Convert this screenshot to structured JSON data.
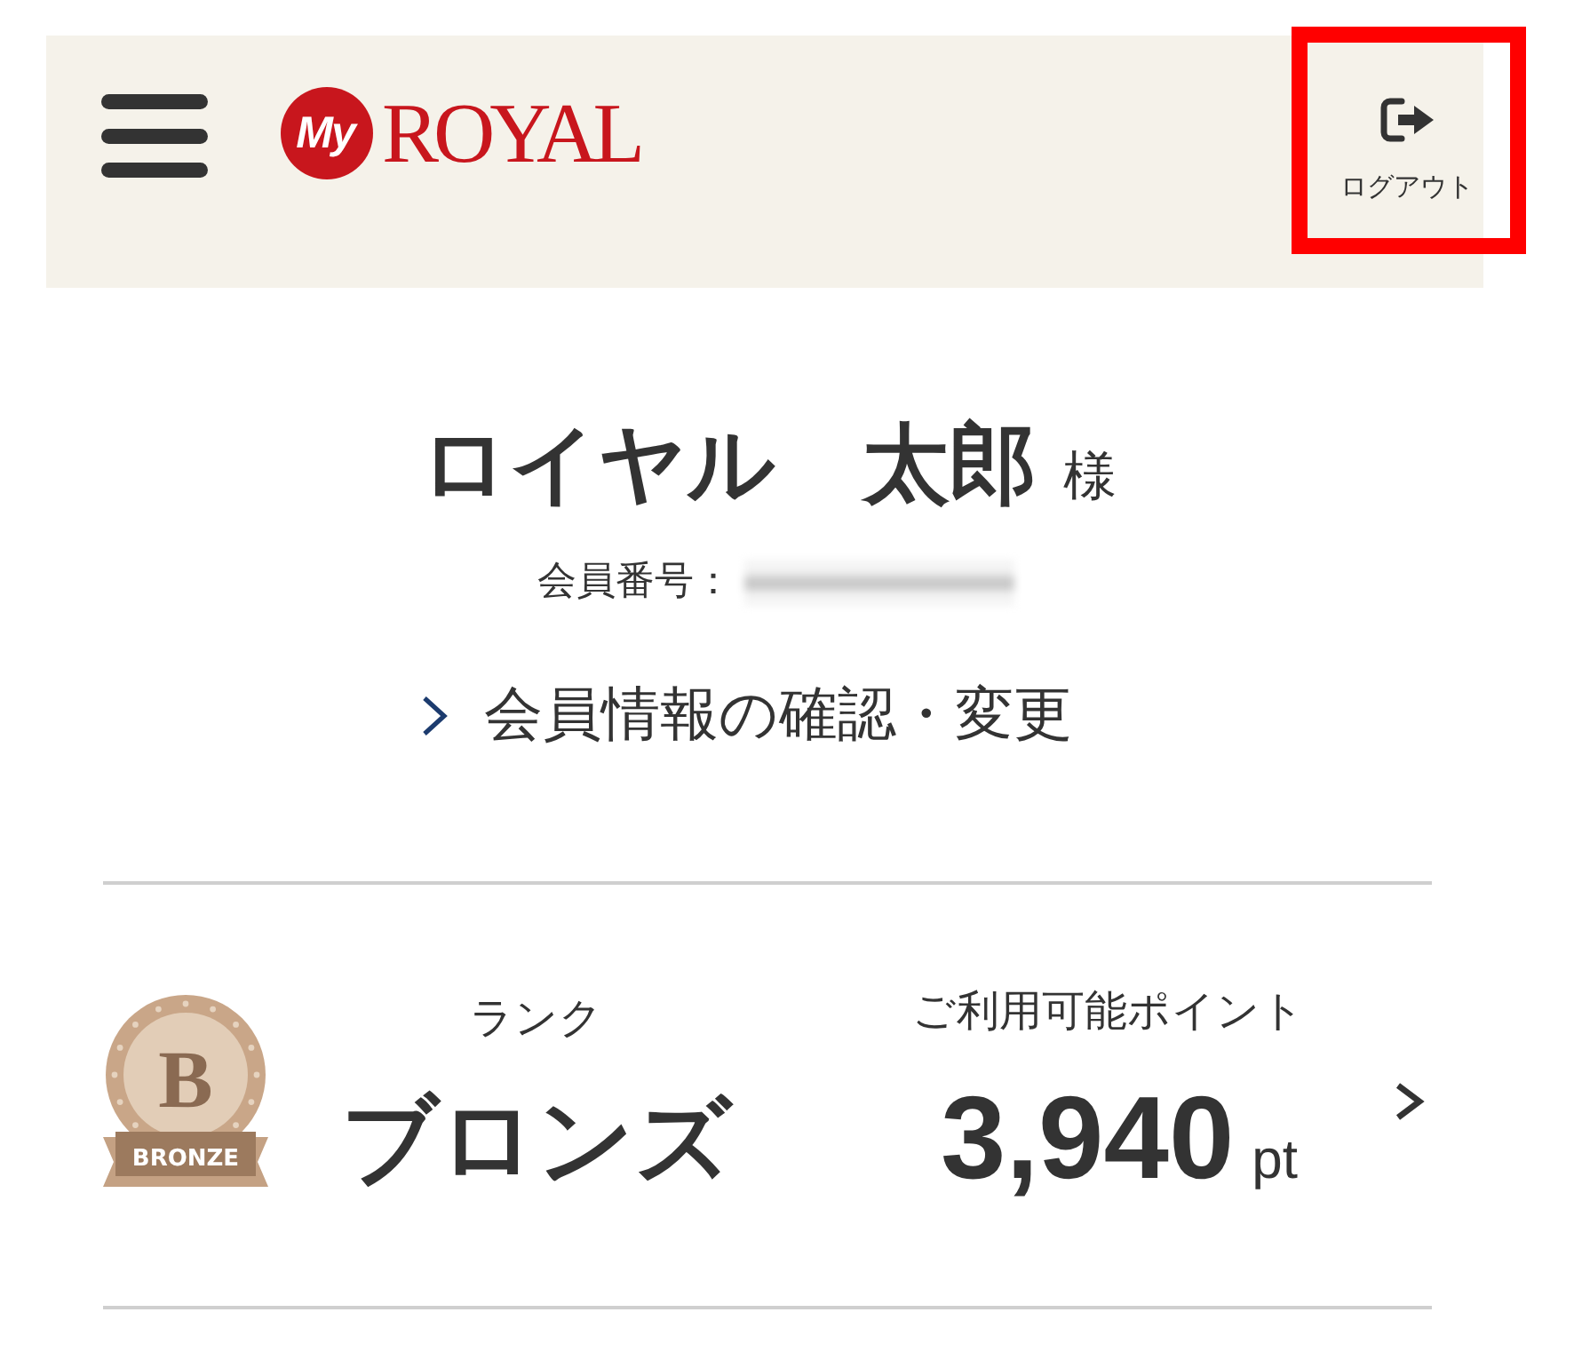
{
  "header": {
    "logo": {
      "emblem": "My",
      "wordmark": "ROYAL"
    },
    "logout": {
      "label": "ログアウト",
      "highlighted": true
    }
  },
  "member": {
    "name": "ロイヤル　太郎",
    "honorific": "様",
    "number_label": "会員番号：",
    "number_redacted": true,
    "info_link": "会員情報の確認・変更"
  },
  "summary": {
    "rank": {
      "label": "ランク",
      "value": "ブロンズ",
      "badge_letter": "B",
      "badge_label": "BRONZE"
    },
    "points": {
      "label": "ご利用可能ポイント",
      "value": "3,940",
      "unit": "pt"
    }
  }
}
